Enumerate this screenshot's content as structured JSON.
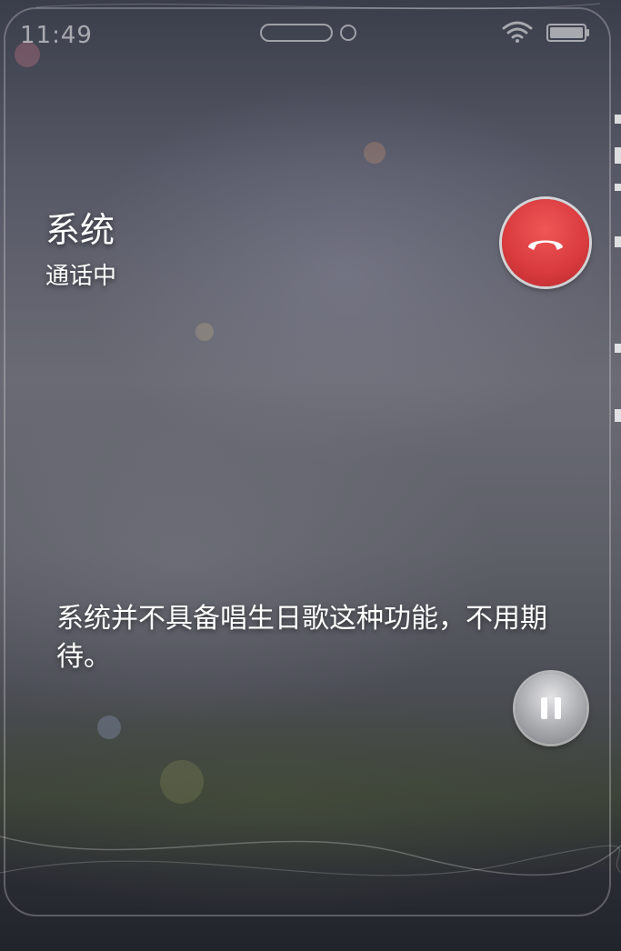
{
  "status_bar": {
    "time": "11:49",
    "wifi_icon": "wifi-icon",
    "battery_icon": "battery-icon"
  },
  "call": {
    "caller_name": "系统",
    "status": "通话中",
    "hangup_icon": "phone-hangup-icon",
    "hangup_color": "#d83a3d"
  },
  "message": {
    "text": "系统并不具备唱生日歌这种功能，不用期待。"
  },
  "controls": {
    "pause_icon": "pause-icon"
  }
}
